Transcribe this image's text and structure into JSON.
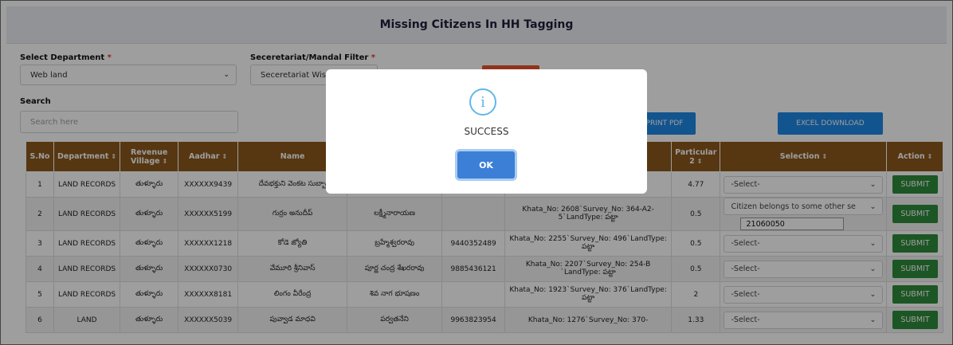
{
  "page_title": "Missing Citizens In HH Tagging",
  "filters": {
    "department_label": "Select Department",
    "department_value": "Web land",
    "secretariat_label": "Seceretariat/Mandal Filter",
    "secretariat_value": "Seceretariat Wis",
    "required_mark": "*"
  },
  "search": {
    "label": "Search",
    "placeholder": "Search here"
  },
  "buttons": {
    "print_pdf": "PRINT PDF",
    "excel_download": "EXCEL DOWNLOAD"
  },
  "table": {
    "headers": [
      "S.No",
      "Department",
      "Revenue Village",
      "Aadhar",
      "Name",
      "",
      "",
      "",
      "Particular 2",
      "Selection",
      "Action"
    ],
    "rows": [
      {
        "sno": "1",
        "dept": "LAND RECORDS",
        "village": "తుళ్ళూరు",
        "aadhar": "XXXXXX9439",
        "name": "దేవభక్తుని వెంకట సుబ్బా",
        "relation": "",
        "phone": "",
        "khata": "LandType: పట్టా",
        "p2": "4.77",
        "selection": "-Select-",
        "extra": "",
        "action": "SUBMIT"
      },
      {
        "sno": "2",
        "dept": "LAND RECORDS",
        "village": "తుళ్ళూరు",
        "aadhar": "XXXXXX5199",
        "name": "గుర్రం అనుదీప్",
        "relation": "లక్ష్మీనారాయణ",
        "phone": "",
        "khata": "Khata_No: 2608`Survey_No: 364-A2-5`LandType: పట్టా",
        "p2": "0.5",
        "selection": "Citizen belongs to some other se",
        "extra": "21060050",
        "action": "SUBMIT"
      },
      {
        "sno": "3",
        "dept": "LAND RECORDS",
        "village": "తుళ్ళూరు",
        "aadhar": "XXXXXX1218",
        "name": "కోడె జ్యోతి",
        "relation": "బ్రహ్మేశ్వరరావు",
        "phone": "9440352489",
        "khata": "Khata_No: 2255`Survey_No: 496`LandType: పట్టా",
        "p2": "0.5",
        "selection": "-Select-",
        "extra": "",
        "action": "SUBMIT"
      },
      {
        "sno": "4",
        "dept": "LAND RECORDS",
        "village": "తుళ్ళూరు",
        "aadhar": "XXXXXX0730",
        "name": "వేమూరి శ్రీనివాస్",
        "relation": "పూర్ణ చంద్ర శేఖరరావు",
        "phone": "9885436121",
        "khata": "Khata_No: 2207`Survey_No: 254-B `LandType: పట్టా",
        "p2": "0.5",
        "selection": "-Select-",
        "extra": "",
        "action": "SUBMIT"
      },
      {
        "sno": "5",
        "dept": "LAND RECORDS",
        "village": "తుళ్ళూరు",
        "aadhar": "XXXXXX8181",
        "name": "లింగం వీరేంద్ర",
        "relation": "శివ నాగ భూషణం",
        "phone": "",
        "khata": "Khata_No: 1923`Survey_No: 376`LandType: పట్టా",
        "p2": "2",
        "selection": "-Select-",
        "extra": "",
        "action": "SUBMIT"
      },
      {
        "sno": "6",
        "dept": "LAND",
        "village": "తుళ్ళూరు",
        "aadhar": "XXXXXX5039",
        "name": "పువ్వాడ మాధవి",
        "relation": "పర్వతనేని",
        "phone": "9963823954",
        "khata": "Khata_No: 1276`Survey_No: 370-",
        "p2": "1.33",
        "selection": "-Select-",
        "extra": "",
        "action": "SUBMIT"
      }
    ]
  },
  "modal": {
    "message": "SUCCESS",
    "ok_label": "OK",
    "icon": "info-icon"
  }
}
